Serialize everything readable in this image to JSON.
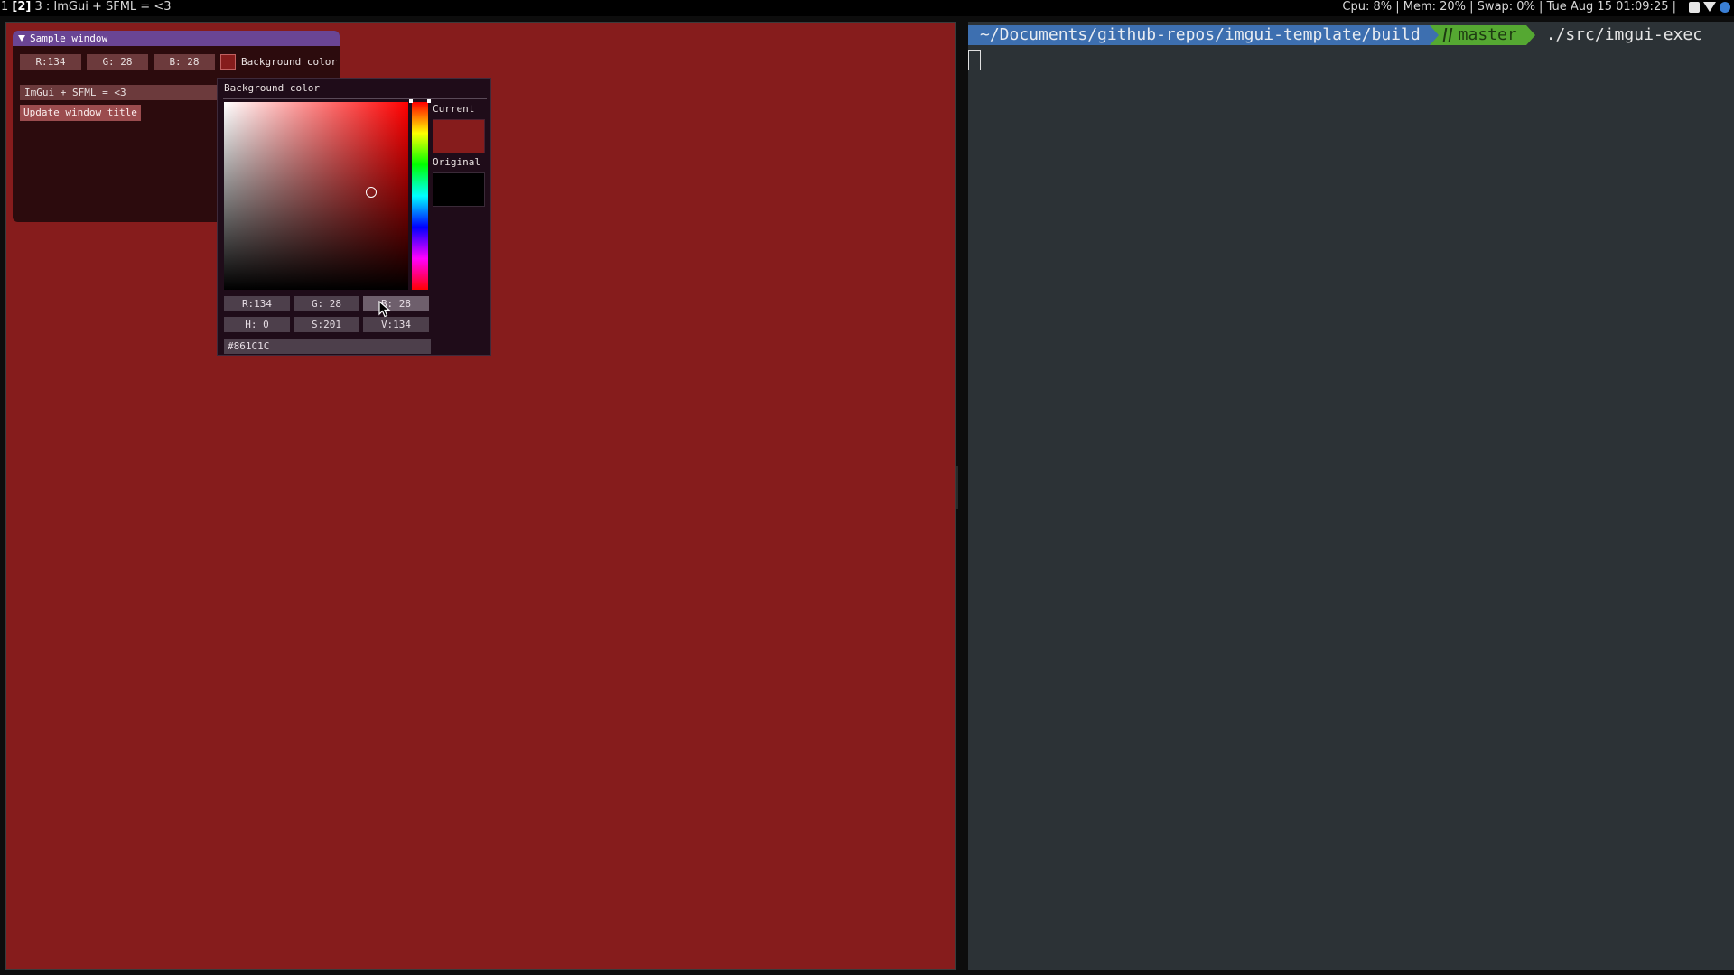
{
  "topbar": {
    "workspace_prefix": "1 ",
    "workspace_active": "[2]",
    "workspace_suffix": " 3 : ImGui + SFML = <3",
    "stats": "Cpu: 8% | Mem: 20% | Swap: 0% | Tue Aug 15 01:09:25 |",
    "tray_icons": [
      "clipboard-icon",
      "wifi-icon",
      "bluetooth-icon"
    ]
  },
  "sample_window": {
    "title": "Sample window",
    "r_field": "R:134",
    "g_field": "G: 28",
    "b_field": "B: 28",
    "color_label": "Background color",
    "title_input_value": "ImGui + SFML = <3",
    "update_button": "Update window title"
  },
  "color_picker": {
    "title": "Background color",
    "current_label": "Current",
    "original_label": "Original",
    "r": "R:134",
    "g": "G: 28",
    "b": "B: 28",
    "h": "H:  0",
    "s": "S:201",
    "v": "V:134",
    "hex": "#861C1C",
    "current_color": "#861C1C",
    "original_color": "#000000"
  },
  "terminal": {
    "path": "~/Documents/github-repos/imgui-template/build",
    "branch": "master",
    "command": "./src/imgui-exec"
  },
  "colors": {
    "background": "#861c1c",
    "terminal_bg": "#2c3236",
    "prompt_path_bg": "#3d6fb0",
    "prompt_git_bg": "#55a832"
  }
}
